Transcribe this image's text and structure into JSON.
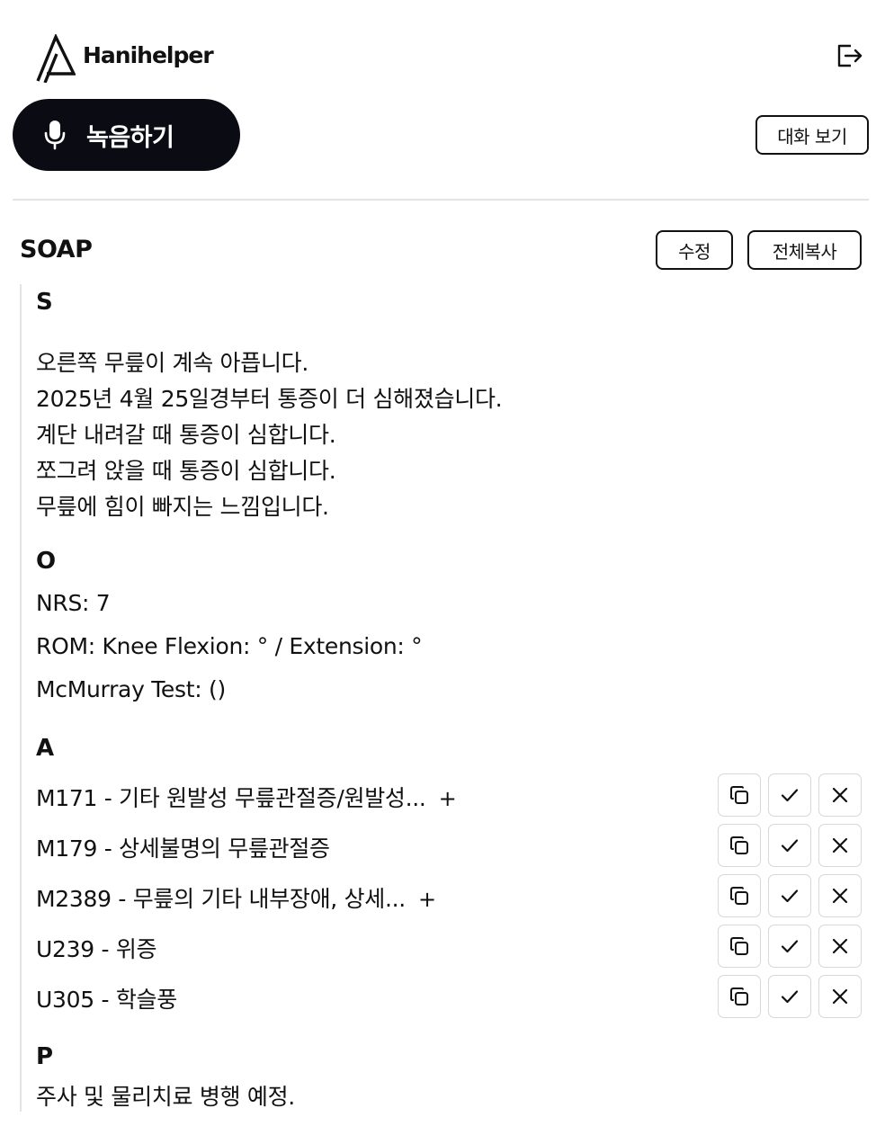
{
  "app": {
    "brand": "Hanihelper"
  },
  "toolbar": {
    "record_label": "녹음하기",
    "view_conversation_label": "대화 보기"
  },
  "soap": {
    "title": "SOAP",
    "edit_label": "수정",
    "copy_all_label": "전체복사",
    "s": {
      "heading": "S",
      "lines": [
        "오른쪽 무릎이 계속 아픕니다.",
        "2025년 4월 25일경부터 통증이 더 심해졌습니다.",
        "계단 내려갈 때 통증이 심합니다.",
        "쪼그려 앉을 때 통증이 심합니다.",
        "무릎에 힘이 빠지는 느낌입니다."
      ]
    },
    "o": {
      "heading": "O",
      "lines": [
        "NRS: 7",
        "ROM: Knee Flexion: ° / Extension: °",
        "McMurray Test: ()"
      ]
    },
    "a": {
      "heading": "A",
      "diagnoses": [
        {
          "text": "M171 - 기타 원발성 무릎관절증/원발성...",
          "more": "+"
        },
        {
          "text": "M179 - 상세불명의 무릎관절증",
          "more": ""
        },
        {
          "text": "M2389 - 무릎의 기타 내부장애, 상세...",
          "more": "+"
        },
        {
          "text": "U239 - 위증",
          "more": ""
        },
        {
          "text": "U305 - 학슬풍",
          "more": ""
        }
      ]
    },
    "p": {
      "heading": "P",
      "lines": [
        "주사 및 물리치료 병행 예정."
      ]
    }
  }
}
